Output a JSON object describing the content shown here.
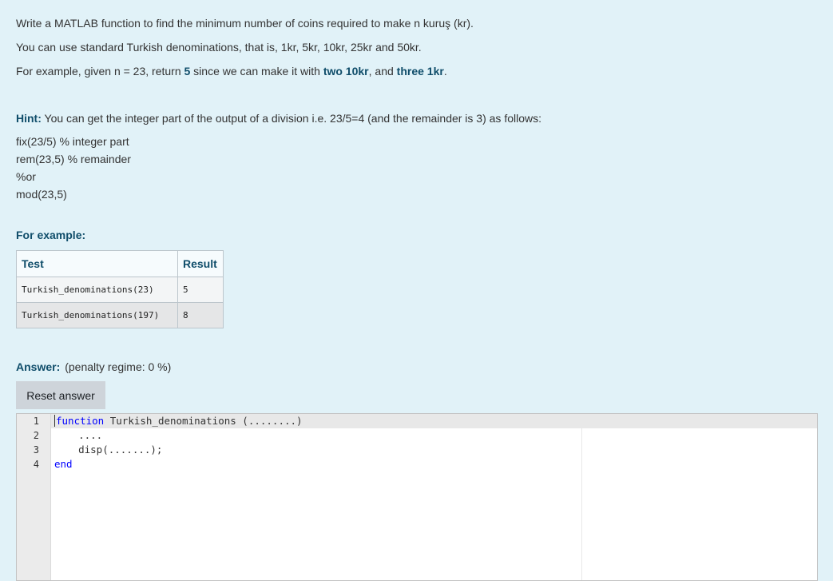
{
  "question": {
    "line1": "Write a MATLAB function to find the minimum number of coins required to make n kuruş (kr).",
    "line2": "You can use standard Turkish denominations, that is, 1kr, 5kr, 10kr, 25kr and 50kr.",
    "line3": {
      "part1": "For example, given n = 23, return ",
      "bold1": "5",
      "part2": " since we can make it with ",
      "bold2": "two 10kr",
      "part3": ", and ",
      "bold3": "three 1kr",
      "part4": "."
    },
    "hint": {
      "label": "Hint:",
      "text": " You can get the integer part of the output of a division i.e. 23/5=4 (and the remainder is 3) as follows:"
    },
    "code_lines": [
      "fix(23/5) % integer part",
      "rem(23,5) % remainder",
      "%or",
      "mod(23,5)"
    ]
  },
  "examples": {
    "heading": "For example:",
    "columns": [
      "Test",
      "Result"
    ],
    "rows": [
      [
        "Turkish_denominations(23)",
        "5"
      ],
      [
        "Turkish_denominations(197)",
        "8"
      ]
    ]
  },
  "answer": {
    "label": "Answer:",
    "penalty": "(penalty regime: 0 %)",
    "reset_label": "Reset answer"
  },
  "editor": {
    "line_numbers": [
      "1",
      "2",
      "3",
      "4"
    ],
    "line1_keyword": "function",
    "line1_rest": " Turkish_denominations (........)",
    "line2": "    ....",
    "line3": "    disp(.......);",
    "line4_keyword": "end",
    "colors": {
      "keyword": "#0000ff",
      "gutter_bg": "#ebebeb",
      "active_line_bg": "#e8e8e8"
    }
  },
  "colors": {
    "page_bg": "#e1f2f8",
    "heading_blue": "#0f4d6a",
    "button_bg": "#ced4da"
  }
}
